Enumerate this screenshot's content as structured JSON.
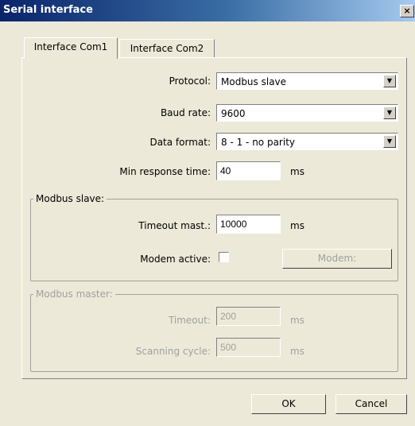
{
  "window": {
    "title": "Serial interface",
    "close_glyph": "×"
  },
  "tabs": [
    {
      "label": "Interface Com1",
      "active": true
    },
    {
      "label": "Interface Com2",
      "active": false
    }
  ],
  "settings": {
    "protocol_label": "Protocol:",
    "protocol_value": "Modbus slave",
    "baud_label": "Baud rate:",
    "baud_value": "9600",
    "format_label": "Data format:",
    "format_value": "8 - 1 - no parity",
    "min_resp_label": "Min response time:",
    "min_resp_value": "40",
    "min_resp_unit": "ms"
  },
  "modbus_slave": {
    "group_title": "Modbus slave:",
    "timeout_label": "Timeout mast.:",
    "timeout_value": "10000",
    "timeout_unit": "ms",
    "modem_label": "Modem active:",
    "modem_checked": false,
    "modem_button": "Modem:"
  },
  "modbus_master": {
    "group_title": "Modbus master:",
    "timeout_label": "Timeout:",
    "timeout_value": "200",
    "timeout_unit": "ms",
    "scan_label": "Scanning cycle:",
    "scan_value": "500",
    "scan_unit": "ms"
  },
  "footer": {
    "ok": "OK",
    "cancel": "Cancel"
  }
}
